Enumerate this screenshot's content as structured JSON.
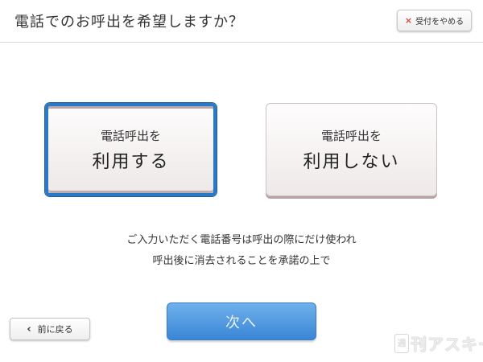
{
  "header": {
    "title": "電話でのお呼出を希望しますか？",
    "cancel_icon": "×",
    "cancel_label": "受付をやめる"
  },
  "choices": [
    {
      "line1": "電話呼出を",
      "line2": "利用する",
      "selected": true
    },
    {
      "line1": "電話呼出を",
      "line2": "利用しない",
      "selected": false
    }
  ],
  "notice": {
    "line1": "ご入力いただく電話番号は呼出の際にだけ使われ",
    "line2": "呼出後に消去されることを承諾の上で"
  },
  "footer": {
    "back_icon": "‹",
    "back_label": "前に戻る",
    "next_label": "次へ"
  },
  "watermark": {
    "box_text": "週",
    "text": "刊アスキー"
  },
  "colors": {
    "accent": "#2a79c9",
    "next_button": "#4a95dc",
    "cancel_icon": "#d9443b"
  }
}
